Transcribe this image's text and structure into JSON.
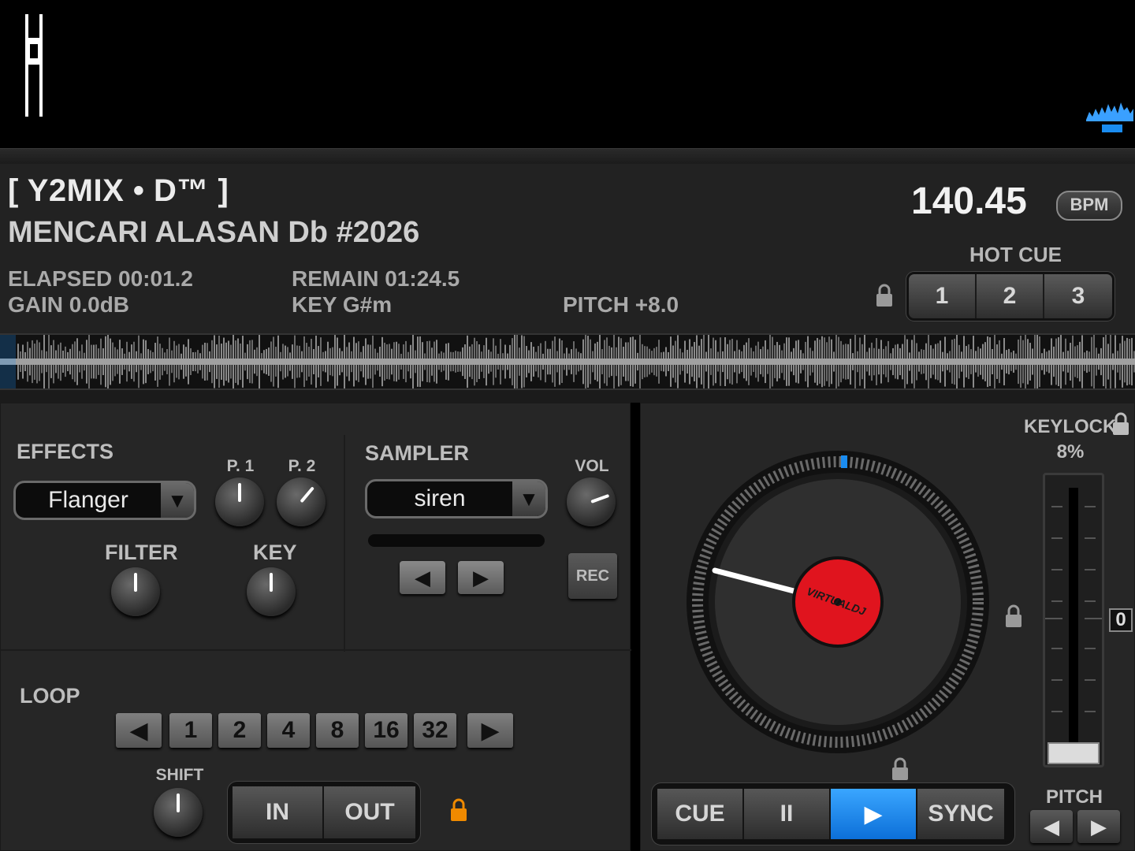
{
  "deck": {
    "title": "[ Y2MIX • D™ ]",
    "subtitle": "MENCARI ALASAN Db #2026",
    "elapsed": "ELAPSED 00:01.2",
    "remain": "REMAIN 01:24.5",
    "gain": "GAIN 0.0dB",
    "key": "KEY G#m",
    "pitch": "PITCH +8.0",
    "bpm_value": "140.45",
    "bpm_label": "BPM",
    "progress_fraction": 0.014
  },
  "hot_cue": {
    "label": "HOT CUE",
    "buttons": [
      "1",
      "2",
      "3"
    ]
  },
  "effects": {
    "label": "EFFECTS",
    "selected": "Flanger",
    "p1_label": "P. 1",
    "p2_label": "P. 2",
    "filter_label": "FILTER",
    "key_label": "KEY"
  },
  "sampler": {
    "label": "SAMPLER",
    "selected": "siren",
    "vol_label": "VOL",
    "rec_label": "REC",
    "prev_arrow": "◀",
    "next_arrow": "▶"
  },
  "loop": {
    "label": "LOOP",
    "prev_arrow": "◀",
    "next_arrow": "▶",
    "sizes": [
      "1",
      "2",
      "4",
      "8",
      "16",
      "32"
    ],
    "shift_label": "SHIFT",
    "in_label": "IN",
    "out_label": "OUT"
  },
  "turntable": {
    "brand": "VIRTUALDJ"
  },
  "keylock": {
    "label": "KEYLOCK",
    "percent": "8%",
    "pitch_value": "0"
  },
  "transport": {
    "cue": "CUE",
    "pause": "II",
    "play": "▶",
    "sync": "SYNC"
  },
  "pitch_control": {
    "label": "PITCH",
    "down": "◀",
    "up": "▶"
  },
  "colors": {
    "accent_blue": "#1a8cf0",
    "platter_red": "#e0141e",
    "lock_orange": "#f08a00"
  }
}
